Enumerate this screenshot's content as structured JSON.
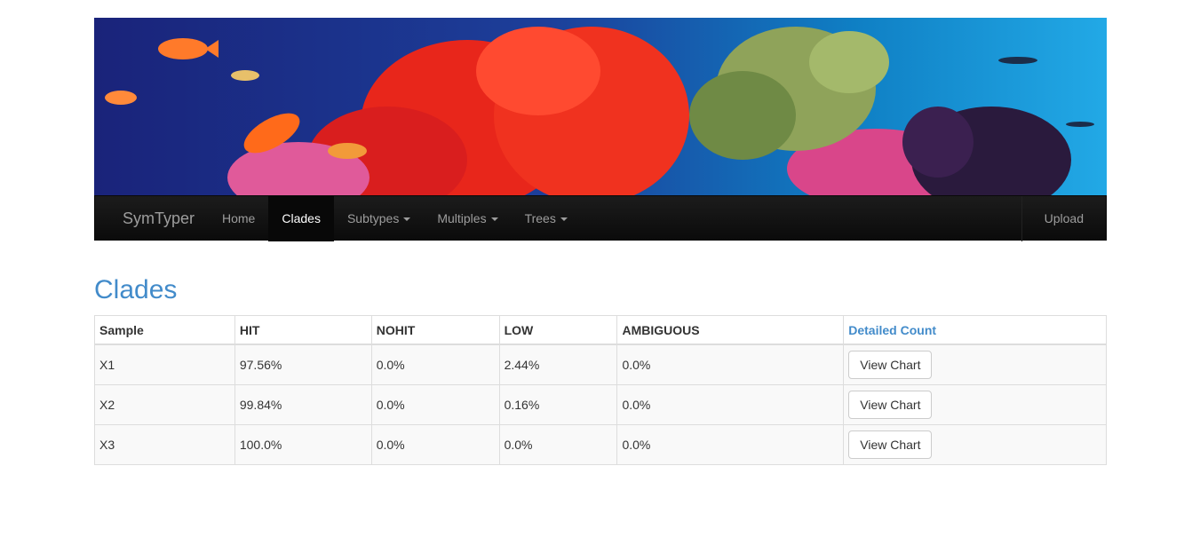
{
  "banner": {
    "image": "coral-reef-banner"
  },
  "navbar": {
    "brand": "SymTyper",
    "items": [
      {
        "label": "Home",
        "active": false,
        "dropdown": false
      },
      {
        "label": "Clades",
        "active": true,
        "dropdown": false
      },
      {
        "label": "Subtypes",
        "active": false,
        "dropdown": true
      },
      {
        "label": "Multiples",
        "active": false,
        "dropdown": true
      },
      {
        "label": "Trees",
        "active": false,
        "dropdown": true
      }
    ],
    "right_item": "Upload"
  },
  "page": {
    "title": "Clades"
  },
  "table": {
    "headers": [
      "Sample",
      "HIT",
      "NOHIT",
      "LOW",
      "AMBIGUOUS",
      "Detailed Count"
    ],
    "rows": [
      {
        "sample": "X1",
        "hit": "97.56%",
        "nohit": "0.0%",
        "low": "2.44%",
        "ambiguous": "0.0%",
        "action": "View Chart"
      },
      {
        "sample": "X2",
        "hit": "99.84%",
        "nohit": "0.0%",
        "low": "0.16%",
        "ambiguous": "0.0%",
        "action": "View Chart"
      },
      {
        "sample": "X3",
        "hit": "100.0%",
        "nohit": "0.0%",
        "low": "0.0%",
        "ambiguous": "0.0%",
        "action": "View Chart"
      }
    ]
  },
  "colors": {
    "navbar_bg": "#111111",
    "link": "#428bca",
    "nav_text": "#9d9d9d"
  }
}
